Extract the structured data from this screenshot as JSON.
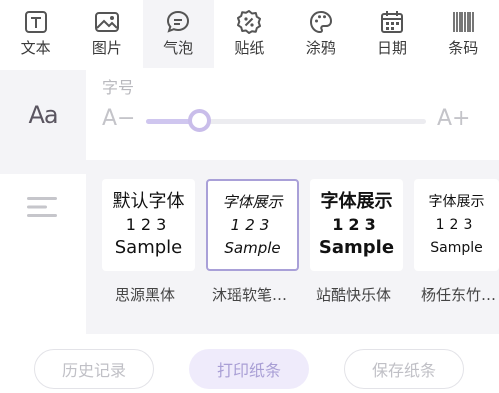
{
  "toolbar": {
    "items": [
      {
        "label": "文本",
        "icon": "text-icon"
      },
      {
        "label": "图片",
        "icon": "image-icon"
      },
      {
        "label": "气泡",
        "icon": "bubble-icon",
        "active": true
      },
      {
        "label": "贴纸",
        "icon": "sticker-icon"
      },
      {
        "label": "涂鸦",
        "icon": "palette-icon"
      },
      {
        "label": "日期",
        "icon": "calendar-icon"
      },
      {
        "label": "条码",
        "icon": "barcode-icon"
      }
    ]
  },
  "font_panel": {
    "side_icon_text": "Aa",
    "size_title": "字号",
    "decrease_label": "A−",
    "increase_label": "A+",
    "size_fraction": 0.19
  },
  "font_cards": [
    {
      "line1": "默认字体",
      "line2": "123",
      "line3": "Sample",
      "name": "思源黑体",
      "selected": false
    },
    {
      "line1": "字体展示",
      "line2": "123",
      "line3": "Sample",
      "name": "沐瑶软笔…",
      "selected": true
    },
    {
      "line1": "字体展示",
      "line2": "123",
      "line3": "Sample",
      "name": "站酷快乐体",
      "selected": false
    },
    {
      "line1": "字体展示",
      "line2": "123",
      "line3": "Sample",
      "name": "杨任东竹…",
      "selected": false
    }
  ],
  "buttons": {
    "history": "历史记录",
    "print": "打印纸条",
    "save": "保存纸条"
  },
  "colors": {
    "accent": "#a99fd5",
    "panel_bg": "#f4f4f7",
    "selected_border": "#a9a0d8"
  }
}
